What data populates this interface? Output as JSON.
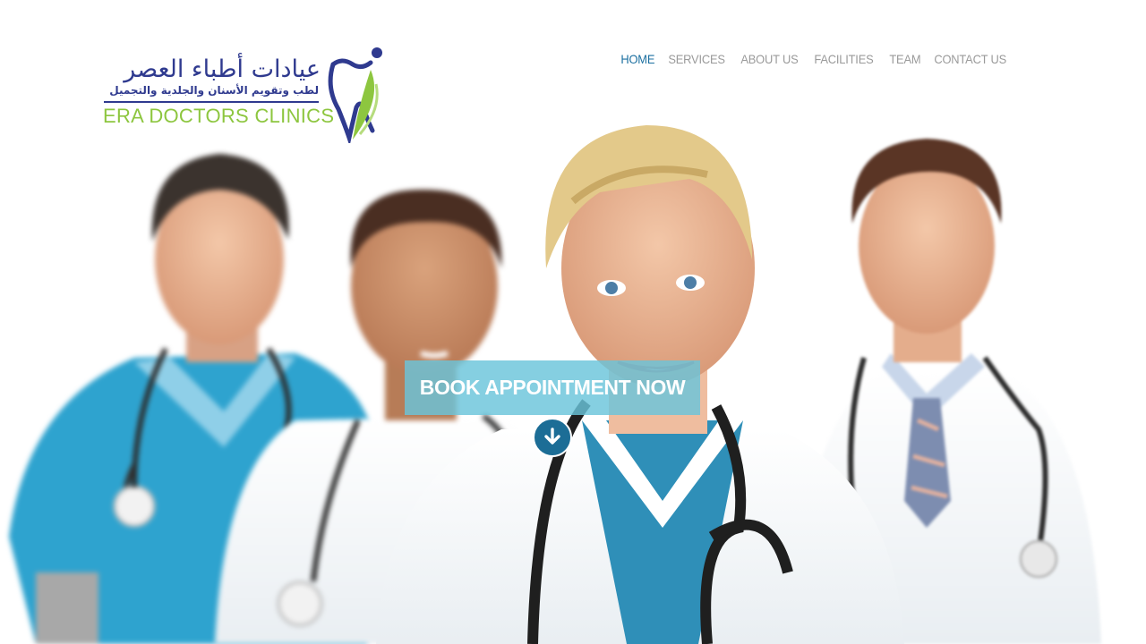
{
  "brand": {
    "arabic_name": "عيادات أطباء العصر",
    "arabic_tagline": "لطب وتقويم الأسنان والجلدية والتجميل",
    "english_name": "ERA DOCTORS CLINICS",
    "icon": "tooth-leaf-logo-icon",
    "colors": {
      "navy": "#2f3a8f",
      "green": "#8dc63f"
    }
  },
  "nav": {
    "items": [
      {
        "label": "HOME",
        "active": true
      },
      {
        "label": "SERVICES",
        "active": false
      },
      {
        "label": "ABOUT US",
        "active": false
      },
      {
        "label": "FACILITIES",
        "active": false
      },
      {
        "label": "TEAM",
        "active": false
      },
      {
        "label": "CONTACT US",
        "active": false
      }
    ],
    "colors": {
      "active": "#1b6fa0",
      "inactive": "#9a9a9a"
    }
  },
  "hero": {
    "image": "group-of-doctors-photo",
    "cta_label": "BOOK APPOINTMENT NOW",
    "cta_color": "#6ac4da",
    "scroll_icon": "arrow-down-circle-icon",
    "scroll_color": "#1c6d96"
  }
}
